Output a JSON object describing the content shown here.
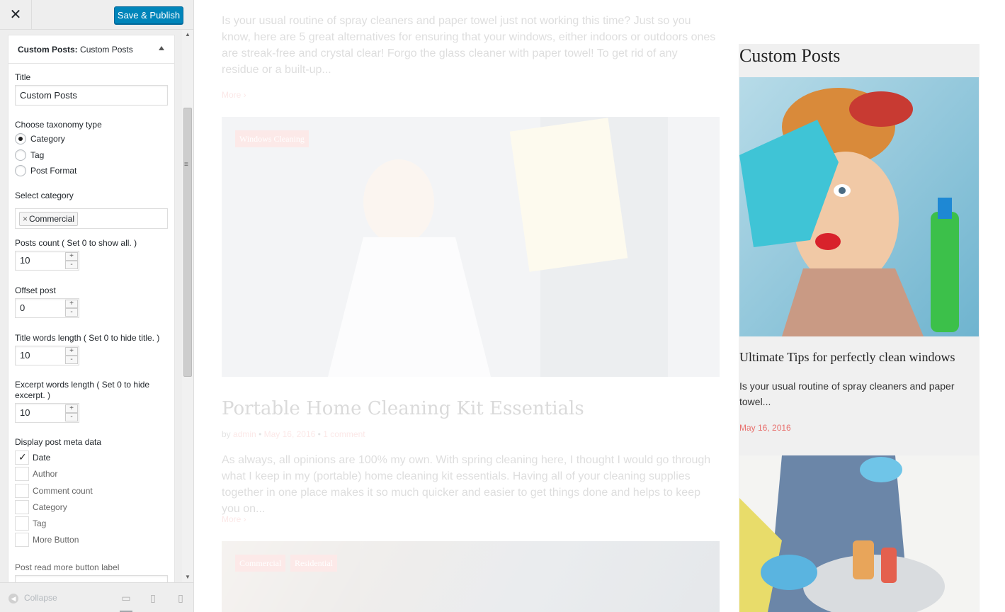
{
  "customizer": {
    "close_icon": "close-icon",
    "publish_label": "Save & Publish",
    "section": {
      "bold": "Custom Posts:",
      "light": "Custom Posts"
    },
    "fields": {
      "title_label": "Title",
      "title_value": "Custom Posts",
      "taxonomy_label": "Choose taxonomy type",
      "taxonomy_options": [
        "Category",
        "Tag",
        "Post Format"
      ],
      "taxonomy_selected": "Category",
      "category_label": "Select category",
      "category_token": "Commercial",
      "posts_count_label": "Posts count ( Set 0 to show all. )",
      "posts_count_value": "10",
      "offset_label": "Offset post",
      "offset_value": "0",
      "title_words_label": "Title words length ( Set 0 to hide title. )",
      "title_words_value": "10",
      "excerpt_words_label": "Excerpt words length ( Set 0 to hide excerpt. )",
      "excerpt_words_value": "10",
      "meta_label": "Display post meta data",
      "meta_options": [
        "Date",
        "Author",
        "Comment count",
        "Category",
        "Tag",
        "More Button"
      ],
      "meta_checked": [
        "Date"
      ],
      "read_more_label": "Post read more button label"
    },
    "footer": {
      "collapse_label": "Collapse"
    }
  },
  "preview": {
    "excerpt_top": "Is your usual routine of spray cleaners and paper towel just not working this time? Just so you know, here are 5 great alternatives for ensuring that your windows, either indoors or outdoors ones are streak-free and crystal clear! Forgo the glass cleaner with paper towel! To get rid of any residue or a built-up...",
    "more_label": "More ›",
    "post1_badge": "Windows Cleaning",
    "post2": {
      "title": "Portable Home Cleaning Kit Essentials",
      "by": "by",
      "author": "admin",
      "date": "May 16, 2016",
      "comments": "1 comment",
      "sep": "•",
      "excerpt": "As always, all opinions are 100% my own. With spring cleaning here, I thought I would go through what I keep in my (portable) home cleaning kit essentials. Having all of your cleaning supplies together in one place makes it so much quicker and easier to get things done and helps to keep you on..."
    },
    "post3_badges": [
      "Commercial",
      "Residential"
    ],
    "widget": {
      "title": "Custom Posts",
      "post_title": "Ultimate Tips for perfectly clean windows",
      "excerpt": "Is your usual routine of spray cleaners and paper towel...",
      "date": "May 16, 2016"
    }
  }
}
